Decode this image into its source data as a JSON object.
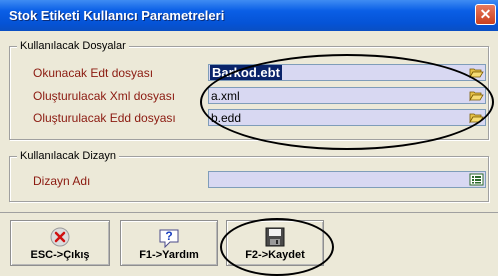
{
  "window": {
    "title": "Stok Etiketi Kullanıcı Parametreleri"
  },
  "files_group": {
    "legend": "Kullanılacak Dosyalar",
    "rows": [
      {
        "label": "Okunacak Edt dosyası",
        "value": "Barkod.ebt",
        "button_icon": "folder-open-icon"
      },
      {
        "label": "Oluşturulacak Xml dosyası",
        "value": "a.xml",
        "button_icon": "folder-open-icon"
      },
      {
        "label": "Oluşturulacak Edd dosyası",
        "value": "b.edd",
        "button_icon": "folder-open-icon"
      }
    ]
  },
  "design_group": {
    "legend": "Kullanılacak Dizayn",
    "rows": [
      {
        "label": "Dizayn Adı",
        "value": "",
        "button_icon": "list-icon"
      }
    ]
  },
  "buttons": [
    {
      "label": "ESC->Çıkış",
      "icon": "close-x-icon"
    },
    {
      "label": "F1->Yardım",
      "icon": "help-question-icon"
    },
    {
      "label": "F2->Kaydet",
      "icon": "save-disk-icon"
    }
  ],
  "colors": {
    "title_bar": "#0553d6",
    "field_bg": "#d8d8f2",
    "label_text": "#8b1a10",
    "selection": "#0a246a"
  }
}
